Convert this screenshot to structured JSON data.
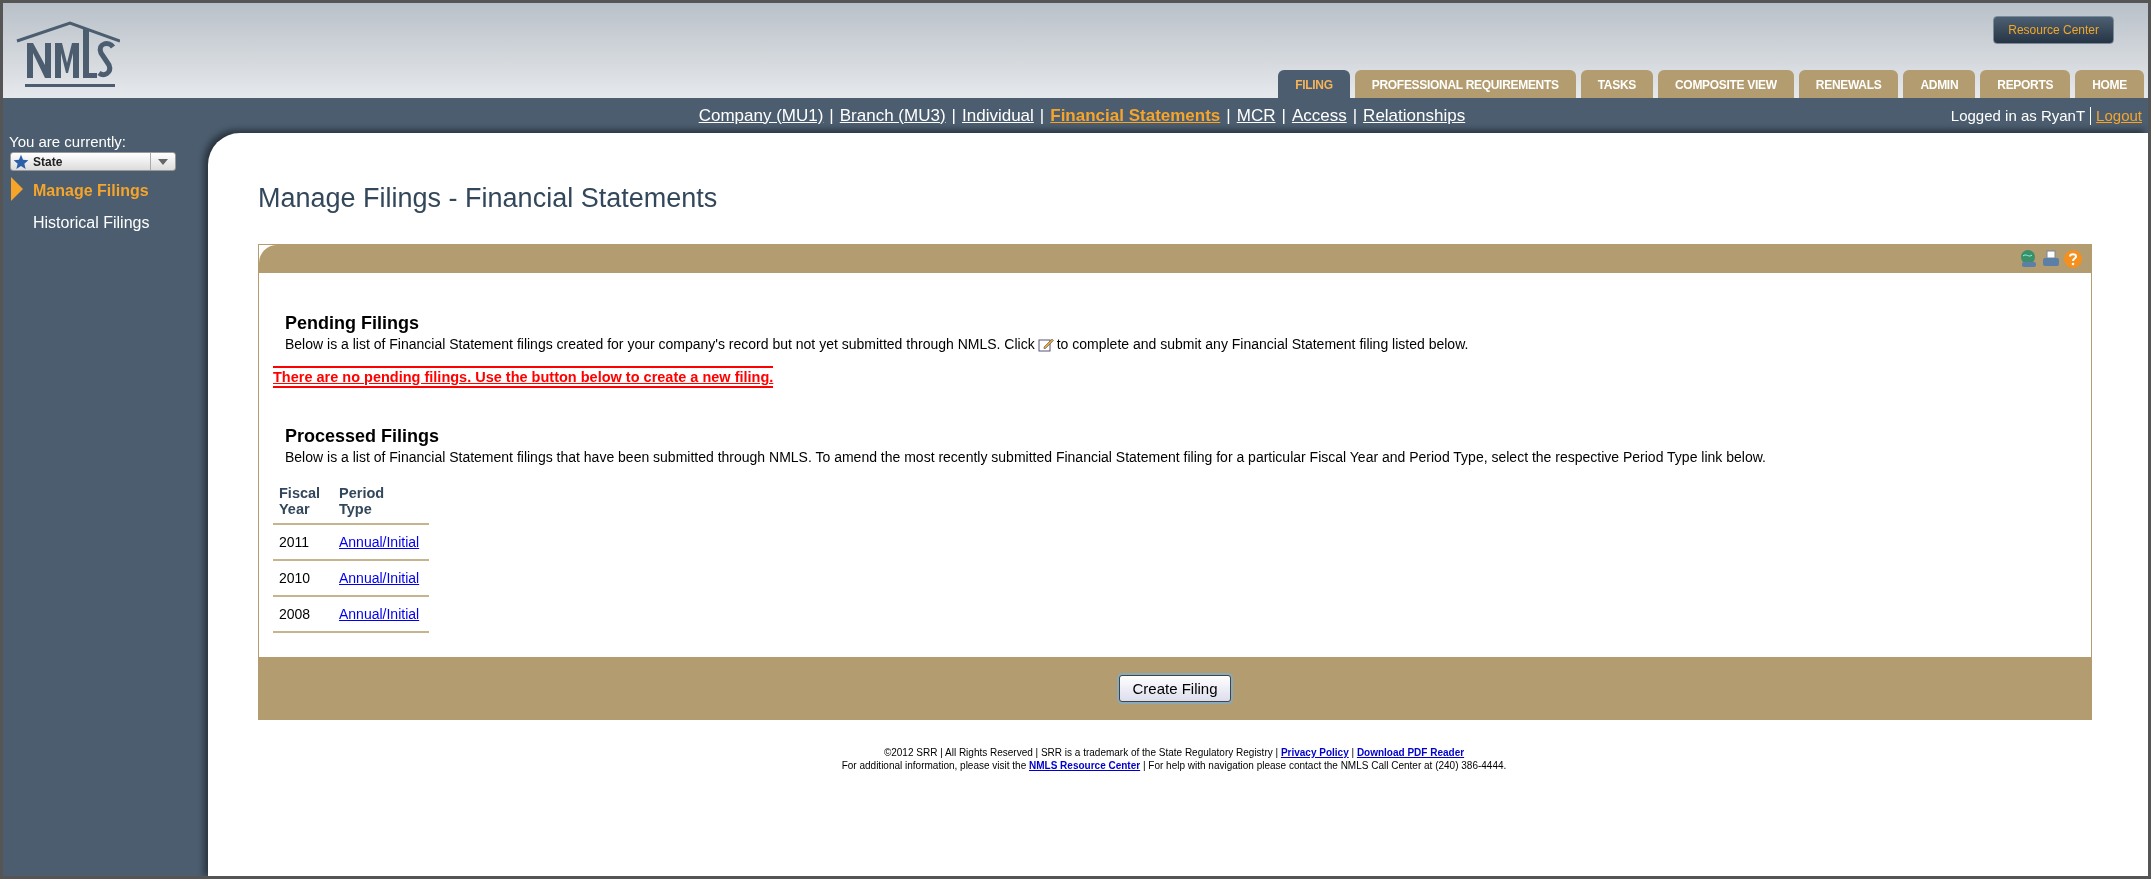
{
  "header": {
    "resource_button": "Resource Center",
    "tabs": [
      {
        "label": "FILING",
        "selected": true
      },
      {
        "label": "PROFESSIONAL REQUIREMENTS",
        "selected": false
      },
      {
        "label": "TASKS",
        "selected": false
      },
      {
        "label": "COMPOSITE VIEW",
        "selected": false
      },
      {
        "label": "RENEWALS",
        "selected": false
      },
      {
        "label": "ADMIN",
        "selected": false
      },
      {
        "label": "REPORTS",
        "selected": false
      },
      {
        "label": "HOME",
        "selected": false
      }
    ]
  },
  "nav": {
    "separator": "|",
    "links": [
      {
        "label": "Company (MU1)",
        "selected": false
      },
      {
        "label": "Branch (MU3)",
        "selected": false
      },
      {
        "label": "Individual",
        "selected": false
      },
      {
        "label": "Financial Statements",
        "selected": true
      },
      {
        "label": "MCR",
        "selected": false
      },
      {
        "label": "Access",
        "selected": false
      },
      {
        "label": "Relationships",
        "selected": false
      }
    ],
    "user": "Logged in as RyanT",
    "logout": "Logout"
  },
  "sidebar": {
    "label": "You are currently:",
    "role": "State",
    "items": [
      {
        "label": "Manage Filings",
        "selected": true
      },
      {
        "label": "Historical Filings",
        "selected": false
      }
    ]
  },
  "page_title": "Manage Filings - Financial Statements",
  "pending": {
    "heading": "Pending Filings",
    "description_before": "Below is a list of Financial Statement filings created for your company's record but not yet submitted through NMLS. Click",
    "description_after": "to complete and submit any Financial Statement filing listed below.",
    "alert": "There are no pending filings. Use the button below to create a new filing."
  },
  "processed": {
    "heading": "Processed Filings",
    "description": "Below is a list of Financial Statement filings that have been submitted through NMLS. To amend the most recently submitted Financial Statement filing for a particular Fiscal Year and Period Type, select the respective Period Type link below.",
    "columns": [
      "Fiscal Year",
      "Period Type"
    ],
    "rows": [
      {
        "fiscal_year": "2011",
        "period_type": "Annual/Initial"
      },
      {
        "fiscal_year": "2010",
        "period_type": "Annual/Initial"
      },
      {
        "fiscal_year": "2008",
        "period_type": "Annual/Initial"
      }
    ]
  },
  "create_button": "Create Filing",
  "footer": {
    "line1": "©2012 SRR | All Rights Reserved | SRR is a trademark of the State Regulatory Registry |",
    "privacy_link": "Privacy Policy",
    "separator": "|",
    "pdf_link": "Download PDF Reader",
    "line2_before": "For additional information, please visit the",
    "resource_link": "NMLS Resource Center",
    "line2_after": "| For help with navigation please contact the NMLS Call Center at (240) 386-4444."
  }
}
